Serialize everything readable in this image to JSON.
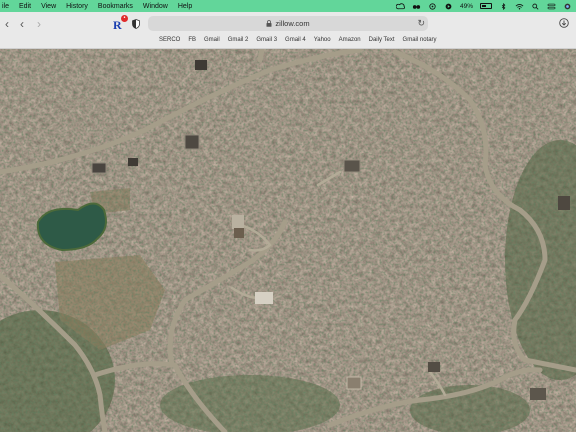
{
  "menubar": {
    "items": [
      "ile",
      "Edit",
      "View",
      "History",
      "Bookmarks",
      "Window",
      "Help"
    ],
    "battery_text": "49%",
    "accent_color": "#62d69a"
  },
  "browser": {
    "url": "zillow.com",
    "extension_badge": "R",
    "bookmarks": [
      "SERCO",
      "FB",
      "Gmail",
      "Gmail 2",
      "Gmail 3",
      "Gmail 4",
      "Yahoo",
      "Amazon",
      "Daily Text",
      "Gmail notary"
    ]
  },
  "map": {
    "type": "satellite"
  }
}
